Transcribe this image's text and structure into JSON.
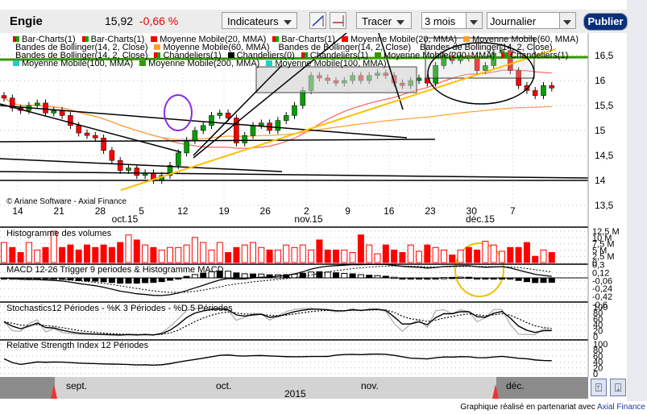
{
  "toolbar": {
    "symbol": "Engie",
    "price": "15,92",
    "change": "-0,66 %",
    "indicators_label": "Indicateurs",
    "draw_label": "Tracer",
    "period_value": "3 mois",
    "interval_value": "Journalier",
    "publish_label": "Publier"
  },
  "legend": {
    "rows": [
      [
        {
          "label": "Bar-Charts(1)",
          "color": "rg"
        },
        {
          "label": "Bar-Charts(1)",
          "color": "rg"
        },
        {
          "label": "Moyenne Mobile(20, MMA)",
          "color": "#ff0000"
        },
        {
          "label": "Bar-Charts(1)",
          "color": "rg"
        },
        {
          "label": "Moyenne Mobile(20, MMA)",
          "color": "#ff0000"
        },
        {
          "label": "Moyenne Mobile(60, MMA)",
          "color": "#ffa030"
        }
      ],
      [
        {
          "label": "Bandes de Bollinger(14, 2, Close)",
          "color": ""
        },
        {
          "label": "Moyenne Mobile(60, MMA)",
          "color": "#ffa030"
        },
        {
          "label": "Bandes de Bollinger(14, 2, Close)",
          "color": ""
        },
        {
          "label": "Bandes de Bollinger(14, 2, Close)",
          "color": ""
        }
      ],
      [
        {
          "label": "Bandes de Bollinger(14, 2, Close)",
          "color": ""
        },
        {
          "label": "Chandeliers(1)",
          "color": "rg"
        },
        {
          "label": "Chandeliers(0)",
          "color": "#000000"
        },
        {
          "label": "Chandeliers(1)",
          "color": "rg"
        },
        {
          "label": "Moyenne Mobile(200, MMA)",
          "color": "#339900"
        },
        {
          "label": "Chandeliers(1)",
          "color": "rg"
        }
      ],
      [
        {
          "label": "Moyenne Mobile(100, MMA)",
          "color": "#22cccc"
        },
        {
          "label": "Moyenne Mobile(200, MMA)",
          "color": "#339900"
        },
        {
          "label": "Moyenne Mobile(100, MMA)",
          "color": "#22cccc"
        }
      ]
    ]
  },
  "copyright": "© Ariane Software - Axial Finance",
  "panels": {
    "volume": "Histogramme des volumes",
    "macd": "MACD 12-26  Trigger 9 periodes & Histogramme MACD",
    "stoch": "Stochastics12 Périodes  -  %K 3 Périodes  -  %D 5 Périodes",
    "rsi": "Relative Strength Index 12 Périodes"
  },
  "scrollbar": {
    "months": [
      "sept.",
      "oct.",
      "nov.",
      "déc."
    ],
    "year": "2015"
  },
  "footer": {
    "text": "Graphique réalisé en partenariat avec ",
    "link": "Axial Finance"
  },
  "colors": {
    "up": "#00a000",
    "down": "#ff0000",
    "ma20": "#ff6060",
    "ma60": "#ffa030",
    "trend": "#ffc000",
    "publish": "#0a2f7a"
  },
  "chart_data": {
    "type": "candlestick",
    "title": "Engie",
    "price_axis": {
      "ticks": [
        "16,5",
        "16",
        "15,5",
        "15",
        "14,5",
        "14",
        "13,5"
      ],
      "values": [
        16.5,
        16,
        15.5,
        15,
        14.5,
        14,
        13.5
      ],
      "range": [
        13.5,
        16.95
      ]
    },
    "date_ticks": [
      "14",
      "21",
      "28",
      "5",
      "12",
      "19",
      "26",
      "2",
      "9",
      "16",
      "23",
      "30",
      "7"
    ],
    "month_labels": [
      "oct.15",
      "nov.15",
      "déc.15"
    ],
    "closes": [
      15.65,
      15.45,
      15.4,
      15.5,
      15.55,
      15.35,
      15.4,
      15.3,
      15.1,
      14.95,
      14.9,
      14.85,
      14.6,
      14.4,
      14.2,
      14.25,
      14.1,
      14.15,
      14.0,
      14.1,
      14.3,
      14.55,
      14.8,
      15.0,
      15.1,
      15.3,
      15.35,
      15.25,
      14.75,
      14.9,
      15.1,
      15.15,
      15.0,
      15.2,
      15.3,
      15.5,
      15.8,
      16.1,
      16.05,
      16.0,
      15.95,
      16.0,
      16.1,
      16.0,
      16.1,
      16.15,
      16.1,
      15.95,
      15.9,
      16.0,
      16.05,
      15.95,
      16.3,
      16.5,
      16.4,
      16.5,
      16.45,
      16.2,
      16.3,
      16.55,
      16.6,
      16.2,
      15.9,
      15.8,
      15.7,
      15.9,
      15.85
    ],
    "volume_axis": {
      "ticks": [
        "12,5 M",
        "10 M",
        "7,5 M",
        "5 M",
        "2,5 M",
        "0"
      ],
      "values": [
        12.5,
        10,
        7.5,
        5,
        2.5,
        0
      ]
    },
    "volumes": [
      8,
      6,
      4,
      8,
      5,
      6,
      12.5,
      6,
      7,
      5,
      7,
      6,
      7,
      6,
      8,
      11,
      9,
      7,
      6,
      5,
      6,
      6,
      7,
      10,
      8,
      5,
      8,
      4,
      6,
      7,
      8,
      6,
      5,
      5,
      7,
      6,
      7,
      5,
      9,
      5,
      5,
      5,
      4,
      11,
      7,
      3.5,
      7,
      5,
      4,
      7,
      4.5,
      7,
      6,
      5,
      3,
      5,
      6,
      5,
      8.5,
      7,
      4.5,
      6,
      6,
      8,
      2.5,
      5,
      4
    ],
    "macd_axis": {
      "ticks": [
        "0,3",
        "0,12",
        "-0,06",
        "-0,24",
        "-0,42",
        "-0,6"
      ],
      "values": [
        0.3,
        0.12,
        -0.06,
        -0.24,
        -0.42,
        -0.6
      ]
    },
    "osc_axis": {
      "ticks": [
        "100",
        "80",
        "60",
        "40",
        "20",
        "0"
      ],
      "values": [
        100,
        80,
        60,
        40,
        20,
        0
      ]
    }
  }
}
